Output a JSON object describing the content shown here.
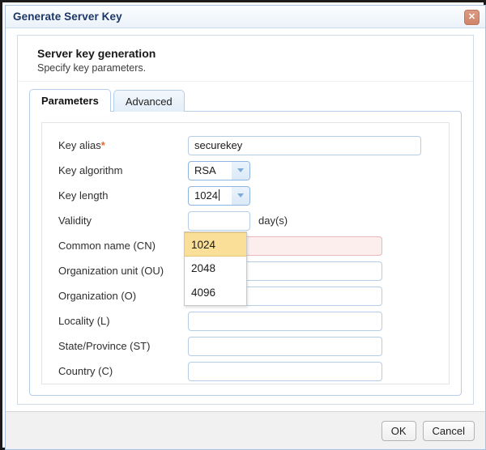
{
  "window": {
    "title": "Generate Server Key",
    "close_icon": "close-icon",
    "close_glyph": "✕"
  },
  "header": {
    "title": "Server key generation",
    "subtitle": "Specify key parameters."
  },
  "tabs": [
    {
      "label": "Parameters",
      "active": true
    },
    {
      "label": "Advanced",
      "active": false
    }
  ],
  "form": {
    "key_alias": {
      "label": "Key alias",
      "required_marker": "*",
      "value": "securekey",
      "placeholder": ""
    },
    "key_algorithm": {
      "label": "Key algorithm",
      "value": "RSA",
      "caret_icon": "chevron-down-icon"
    },
    "key_length": {
      "label": "Key length",
      "value": "1024",
      "caret_icon": "chevron-down-icon",
      "options": [
        "1024",
        "2048",
        "4096"
      ],
      "selected_option": "1024",
      "open": true
    },
    "validity": {
      "label": "Validity",
      "value": "",
      "unit": "day(s)"
    },
    "common_name": {
      "label": "Common name (CN)",
      "value": "",
      "error": true
    },
    "organization_unit": {
      "label": "Organization unit (OU)",
      "value": ""
    },
    "organization": {
      "label": "Organization (O)",
      "value": ""
    },
    "locality": {
      "label": "Locality (L)",
      "value": ""
    },
    "state_province": {
      "label": "State/Province (ST)",
      "value": ""
    },
    "country": {
      "label": "Country (C)",
      "value": ""
    }
  },
  "footer": {
    "ok_label": "OK",
    "cancel_label": "Cancel"
  },
  "colors": {
    "title_text": "#1a3768",
    "close_button": "#cf8569",
    "accent_border": "#b5cde6",
    "required_marker": "#e06a2a",
    "error_field_bg": "#fdeeee",
    "dropdown_highlight": "#fadf98",
    "footer_bg": "#f1f1f1"
  }
}
